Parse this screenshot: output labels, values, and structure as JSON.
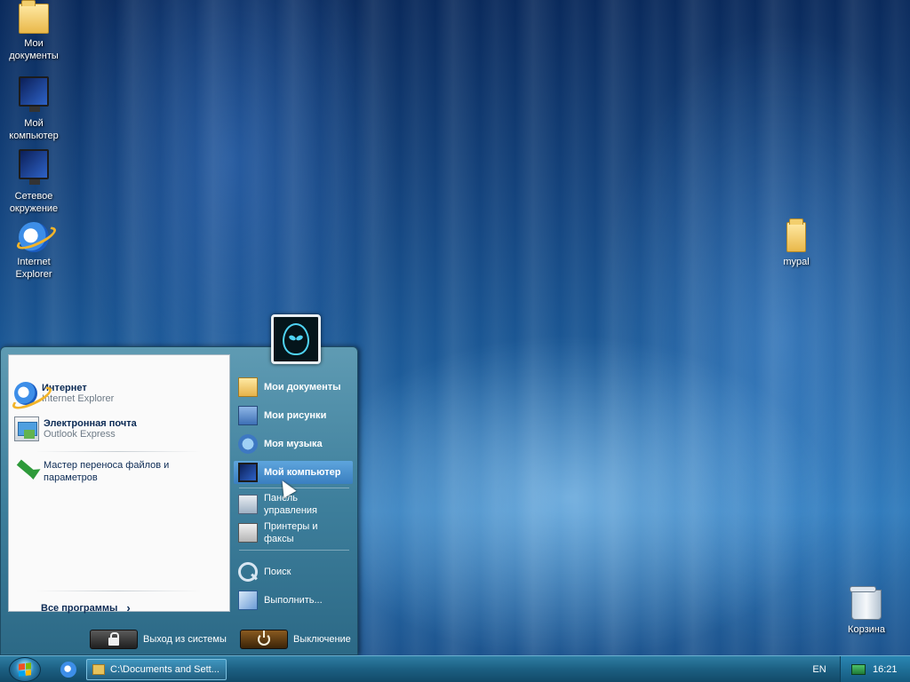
{
  "desktop": {
    "icons": [
      {
        "label": "Мои документы",
        "icon": "folder-icon"
      },
      {
        "label": "Мой компьютер",
        "icon": "monitor-icon"
      },
      {
        "label": "Сетевое окружение",
        "icon": "network-icon"
      },
      {
        "label": "Internet Explorer",
        "icon": "ie-icon"
      },
      {
        "label": "mypal",
        "icon": "folder-icon"
      },
      {
        "label": "Корзина",
        "icon": "recycle-bin-icon"
      }
    ]
  },
  "start_menu": {
    "pinned": [
      {
        "title": "Интернет",
        "subtitle": "Internet Explorer",
        "icon": "ie-icon"
      },
      {
        "title": "Электронная почта",
        "subtitle": "Outlook Express",
        "icon": "mail-icon"
      }
    ],
    "recent": [
      {
        "label": "Мастер переноса файлов и параметров",
        "icon": "transfer-wizard-icon"
      }
    ],
    "all_programs": "Все программы",
    "right_items": [
      {
        "label": "Мои документы",
        "icon": "folder-icon",
        "bold": true
      },
      {
        "label": "Мои рисунки",
        "icon": "pictures-icon",
        "bold": true
      },
      {
        "label": "Моя музыка",
        "icon": "music-icon",
        "bold": true
      },
      {
        "label": "Мой компьютер",
        "icon": "monitor-icon",
        "bold": true,
        "highlighted": true
      },
      {
        "label": "Панель управления",
        "icon": "control-panel-icon"
      },
      {
        "label": "Принтеры и факсы",
        "icon": "printer-icon"
      },
      {
        "label": "Поиск",
        "icon": "search-icon"
      },
      {
        "label": "Выполнить...",
        "icon": "run-icon"
      }
    ],
    "logoff_label": "Выход из системы",
    "shutdown_label": "Выключение"
  },
  "taskbar": {
    "task_button": "C:\\Documents and Sett...",
    "language": "EN",
    "clock": "16:21"
  },
  "colors": {
    "menu_accent": "#3e7f9c",
    "highlight": "#3a7fc0",
    "taskbar": "#1c5f82"
  }
}
